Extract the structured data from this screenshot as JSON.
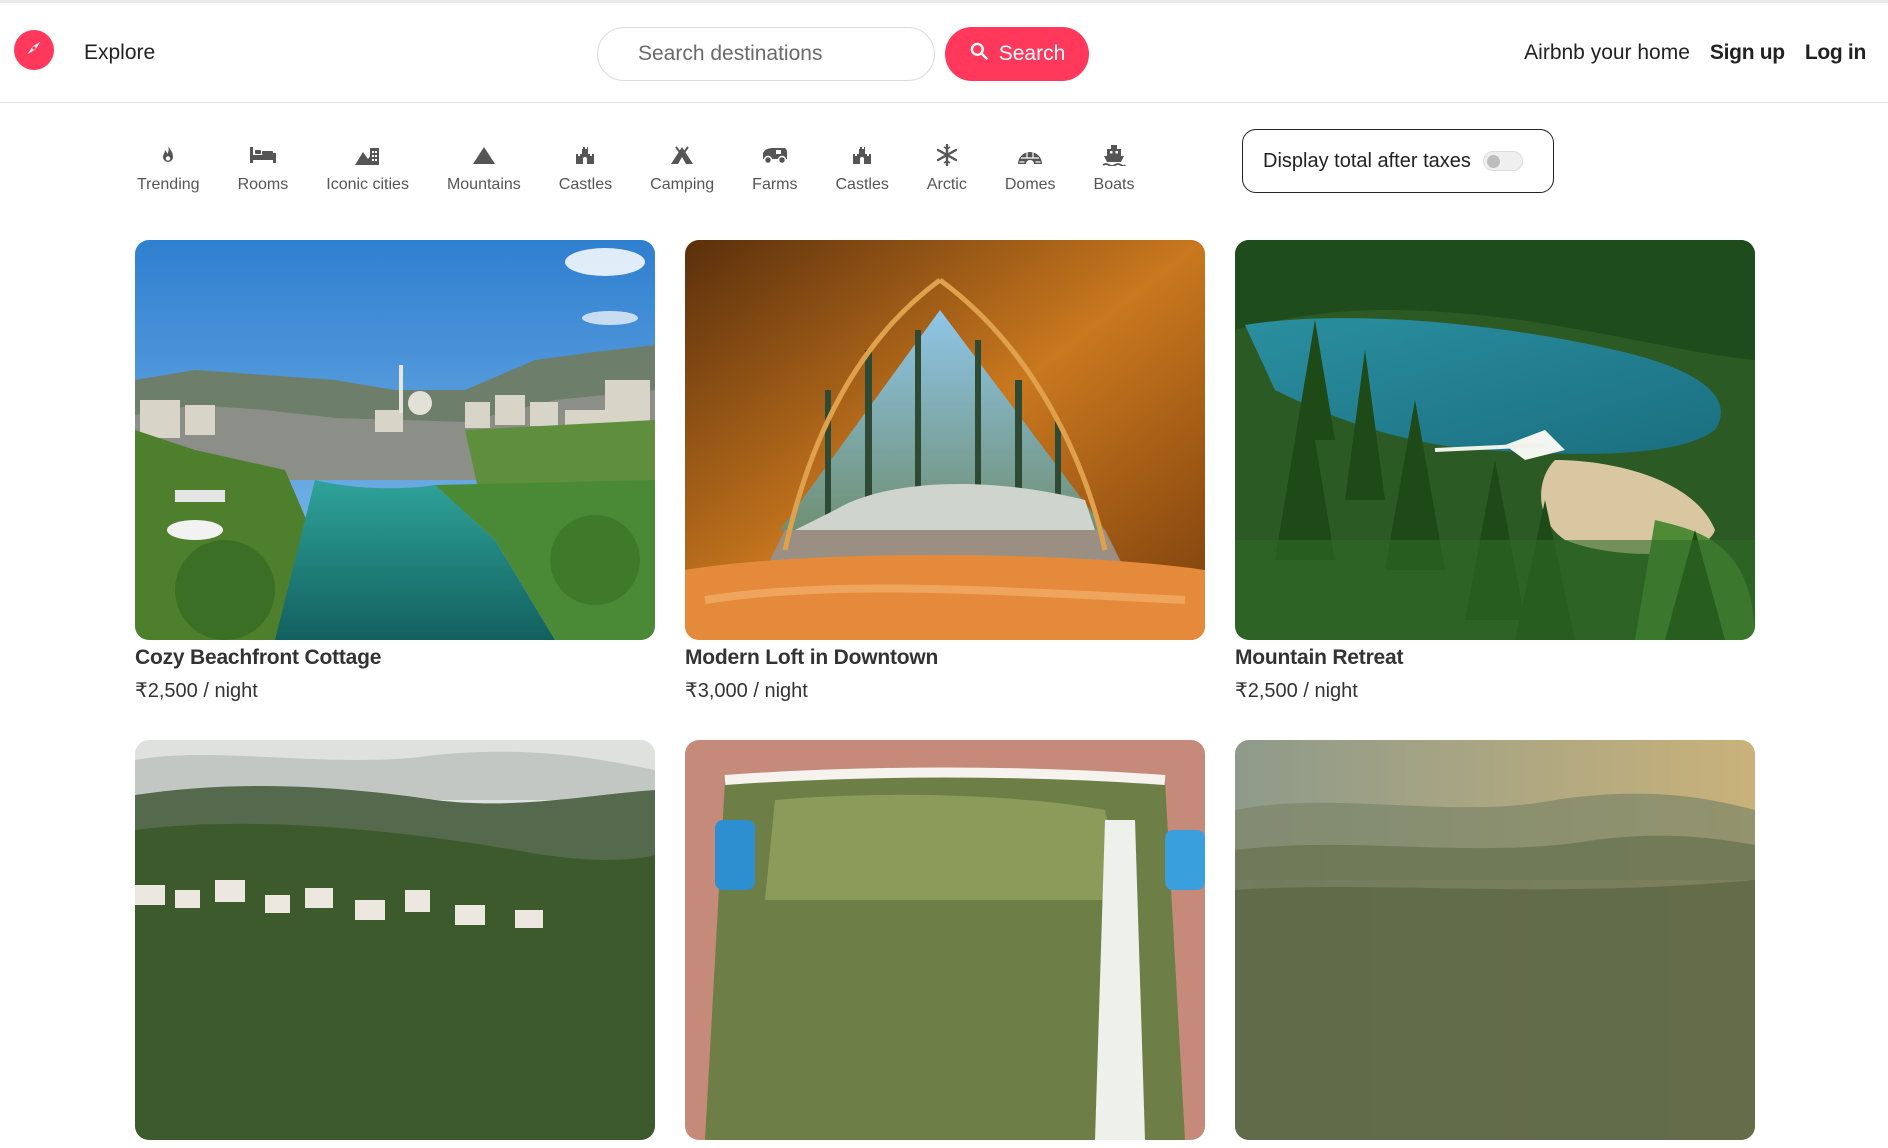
{
  "header": {
    "logo_icon": "compass-icon",
    "explore_label": "Explore",
    "search": {
      "placeholder": "Search destinations",
      "value": "",
      "button_label": "Search",
      "button_icon": "search-icon"
    },
    "host_link": "Airbnb your home",
    "signup_label": "Sign up",
    "login_label": "Log in",
    "accent_color": "#ff385c"
  },
  "categories": [
    {
      "label": "Trending",
      "icon": "flame-icon"
    },
    {
      "label": "Rooms",
      "icon": "bed-icon"
    },
    {
      "label": "Iconic cities",
      "icon": "city-icon"
    },
    {
      "label": "Mountains",
      "icon": "mountain-icon"
    },
    {
      "label": "Castles",
      "icon": "castle-icon"
    },
    {
      "label": "Camping",
      "icon": "tent-icon"
    },
    {
      "label": "Farms",
      "icon": "tractor-icon"
    },
    {
      "label": "Castles",
      "icon": "castle-icon"
    },
    {
      "label": "Arctic",
      "icon": "snowflake-icon"
    },
    {
      "label": "Domes",
      "icon": "igloo-icon"
    },
    {
      "label": "Boats",
      "icon": "ship-icon"
    }
  ],
  "tax_toggle": {
    "label": "Display total after taxes",
    "on": false
  },
  "listings": [
    {
      "title": "Cozy Beachfront Cottage",
      "price": "₹2,500 / night",
      "image": "river-town-photo"
    },
    {
      "title": "Modern Loft in Downtown",
      "price": "₹3,000 / night",
      "image": "tent-forest-photo"
    },
    {
      "title": "Mountain Retreat",
      "price": "₹2,500 / night",
      "image": "lake-forest-photo"
    },
    {
      "title": "",
      "price": "",
      "image": "hillside-town-photo"
    },
    {
      "title": "",
      "price": "",
      "image": "waterfall-photo"
    },
    {
      "title": "",
      "price": "",
      "image": "misty-hills-photo"
    }
  ]
}
